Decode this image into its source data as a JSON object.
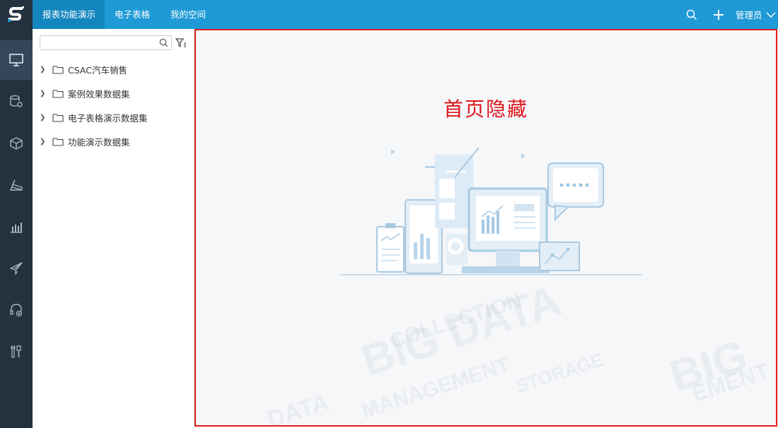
{
  "topnav": {
    "tabs": [
      {
        "label": "报表功能演示"
      },
      {
        "label": "电子表格"
      },
      {
        "label": "我的空间"
      }
    ],
    "user_label": "管理员"
  },
  "sidebar": {
    "icons": [
      "monitor-icon",
      "database-gear-icon",
      "cube-icon",
      "layers-icon",
      "bar-chart-icon",
      "paper-plane-icon",
      "headset-icon",
      "tools-icon"
    ]
  },
  "tree": {
    "search": {
      "value": "",
      "placeholder": ""
    },
    "items": [
      {
        "label": "CSAC汽车销售"
      },
      {
        "label": "案例效果数据集"
      },
      {
        "label": "电子表格演示数据集"
      },
      {
        "label": "功能演示数据集"
      }
    ]
  },
  "main": {
    "title": "首页隐藏"
  },
  "colors": {
    "topbar": "#1f9ad6",
    "sidebar": "#243240",
    "title_red": "#e0141b",
    "border_red": "#e01e1e"
  }
}
